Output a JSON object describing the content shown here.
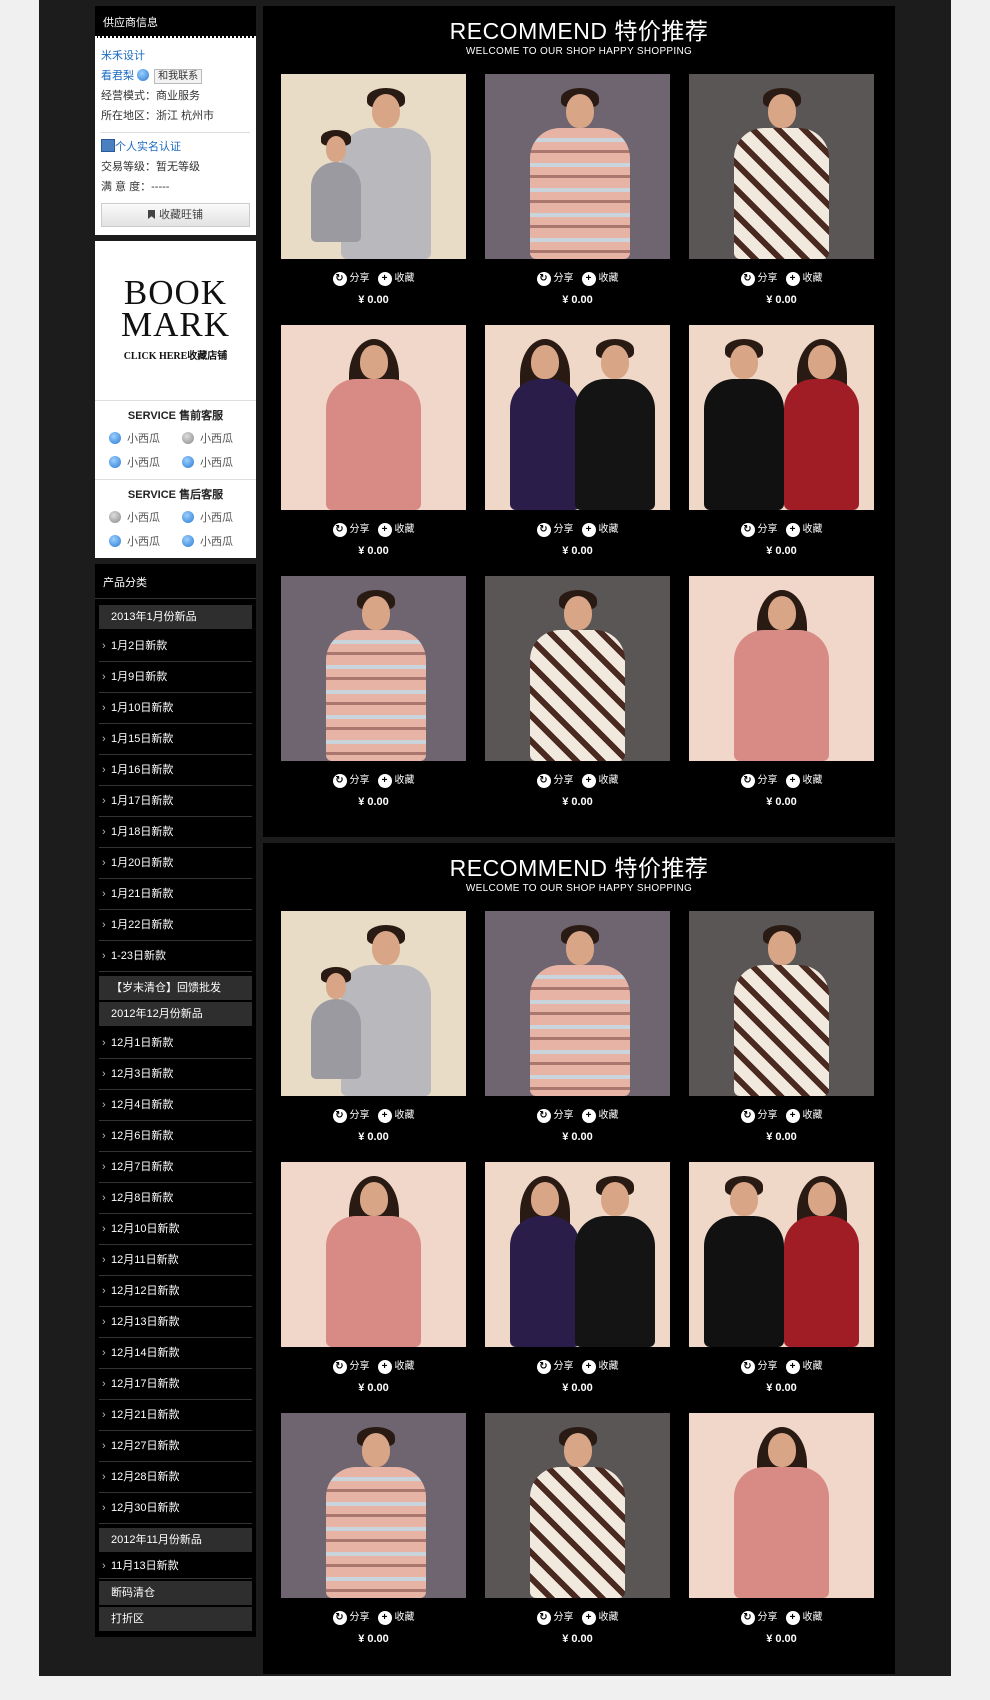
{
  "supplier": {
    "header": "供应商信息",
    "name": "米禾设计",
    "contact_name": "看君梨",
    "contact_button": "和我联系",
    "mode_label": "经营模式：",
    "mode_value": "商业服务",
    "region_label": "所在地区：",
    "region_value": "浙江 杭州市",
    "cert_text": "个人实名认证",
    "level_label": "交易等级：",
    "level_value": "暂无等级",
    "satisfaction_label": "满 意 度：",
    "satisfaction_value": "-----",
    "favorite_button": "收藏旺铺"
  },
  "bookmark": {
    "line1": "BOOK",
    "line2": "MARK",
    "click_text": "CLICK HERE收藏店铺"
  },
  "service": {
    "presale_title": "SERVICE 售前客服",
    "presale_agents": [
      "小西瓜",
      "小西瓜",
      "小西瓜",
      "小西瓜"
    ],
    "aftersale_title": "SERVICE 售后客服",
    "aftersale_agents": [
      "小西瓜",
      "小西瓜",
      "小西瓜",
      "小西瓜"
    ]
  },
  "categories": {
    "header": "产品分类",
    "group1": "2013年1月份新品",
    "group1_items": [
      "1月2日新款",
      "1月9日新款",
      "1月10日新款",
      "1月15日新款",
      "1月16日新款",
      "1月17日新款",
      "1月18日新款",
      "1月20日新款",
      "1月21日新款",
      "1月22日新款",
      "1-23日新款"
    ],
    "group2": "【岁末清仓】回馈批发",
    "group3": "2012年12月份新品",
    "group3_items": [
      "12月1日新款",
      "12月3日新款",
      "12月4日新款",
      "12月6日新款",
      "12月7日新款",
      "12月8日新款",
      "12月10日新款",
      "12月11日新款",
      "12月12日新款",
      "12月13日新款",
      "12月14日新款",
      "12月17日新款",
      "12月21日新款",
      "12月27日新款",
      "12月28日新款",
      "12月30日新款"
    ],
    "group4": "2012年11月份新品",
    "group4_items": [
      "11月13日新款"
    ],
    "group5": "断码清仓",
    "group6": "打折区"
  },
  "panel1": {
    "title": "RECOMMEND 特价推荐",
    "subtitle": "WELCOME TO OUR SHOP HAPPY SHOPPING"
  },
  "panel2": {
    "title": "RECOMMEND 特价推荐",
    "subtitle": "WELCOME TO OUR SHOP HAPPY SHOPPING"
  },
  "product": {
    "share": "分享",
    "collect": "收藏",
    "price": "¥ 0.00"
  }
}
